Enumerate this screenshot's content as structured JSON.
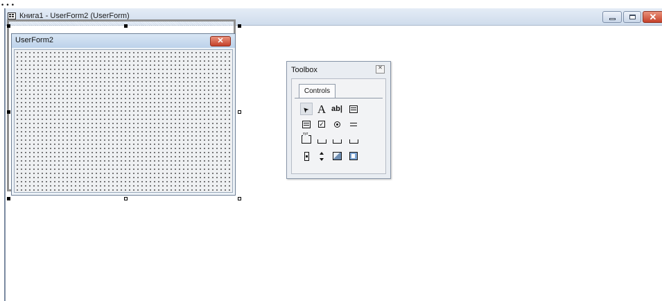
{
  "background_text": "…",
  "window": {
    "title": "Книга1 - UserForm2 (UserForm)",
    "minimize_icon": "minimize-icon",
    "maximize_icon": "maximize-icon",
    "close_icon": "close-icon"
  },
  "userform": {
    "title": "UserForm2",
    "close_icon": "close-icon",
    "grid": "dotted"
  },
  "toolbox": {
    "title": "Toolbox",
    "close_icon": "close-icon",
    "tab_label": "Controls",
    "tools": [
      {
        "name": "Select Objects",
        "icon": "pointer-arrow-icon",
        "glyph": "➤"
      },
      {
        "name": "Label",
        "icon": "label-icon",
        "glyph": "A"
      },
      {
        "name": "TextBox",
        "icon": "textbox-icon",
        "glyph": "ab|"
      },
      {
        "name": "ComboBox",
        "icon": "combobox-icon"
      },
      {
        "name": "ListBox",
        "icon": "listbox-icon"
      },
      {
        "name": "CheckBox",
        "icon": "checkbox-icon",
        "glyph": "✓"
      },
      {
        "name": "OptionButton",
        "icon": "option-button-icon"
      },
      {
        "name": "ToggleButton",
        "icon": "toggle-button-icon"
      },
      {
        "name": "Frame",
        "icon": "frame-icon"
      },
      {
        "name": "CommandButton",
        "icon": "command-button-icon"
      },
      {
        "name": "TabStrip",
        "icon": "tabstrip-icon"
      },
      {
        "name": "MultiPage",
        "icon": "multipage-icon"
      },
      {
        "name": "ScrollBar",
        "icon": "scrollbar-icon"
      },
      {
        "name": "SpinButton",
        "icon": "spin-button-icon"
      },
      {
        "name": "Image",
        "icon": "image-icon"
      },
      {
        "name": "RefEdit",
        "icon": "refedit-icon"
      }
    ]
  },
  "colors": {
    "title_gradient_top": "#e4ecf6",
    "title_gradient_bottom": "#cfdcec",
    "close_red": "#c5412a",
    "form_grid_dot": "#222222"
  }
}
